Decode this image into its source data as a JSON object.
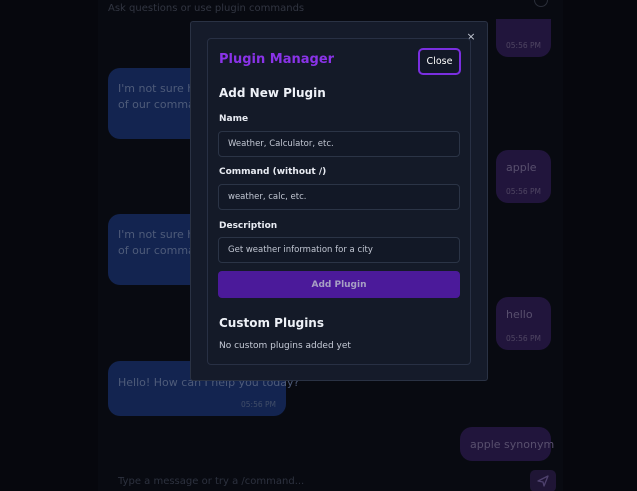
{
  "chat": {
    "subtitle": "Ask questions or use plugin commands",
    "messages": [
      {
        "role": "user",
        "text": "",
        "time": "05:56 PM"
      },
      {
        "role": "bot",
        "text": "I'm not sure how to\nof our commands",
        "time": ""
      },
      {
        "role": "user",
        "text": "apple",
        "time": "05:56 PM"
      },
      {
        "role": "bot",
        "text": "I'm not sure how to\nof our commands",
        "time": ""
      },
      {
        "role": "user",
        "text": "hello",
        "time": "05:56 PM"
      },
      {
        "role": "bot",
        "text": "Hello! How can I help you today?",
        "time": "05:56 PM"
      },
      {
        "role": "user",
        "text": "apple synonym",
        "time": ""
      }
    ],
    "input_placeholder": "Type a message or try a /command..."
  },
  "icons": {
    "header": "chevron-icon",
    "send": "send-icon",
    "modal_close": "close-x-icon"
  },
  "modal": {
    "x_glyph": "×",
    "title": "Plugin Manager",
    "close_label": "Close",
    "add_heading": "Add New Plugin",
    "fields": {
      "name": {
        "label": "Name",
        "placeholder": "Weather, Calculator, etc."
      },
      "command": {
        "label": "Command (without /)",
        "placeholder": "weather, calc, etc."
      },
      "description": {
        "label": "Description",
        "placeholder": "Get weather information for a city"
      }
    },
    "add_button": "Add Plugin",
    "custom_heading": "Custom Plugins",
    "empty_note": "No custom plugins added yet"
  },
  "colors": {
    "accent": "#8a33e8",
    "button": "#4b1a9a",
    "bot_bubble": "#1b3370",
    "user_bubble": "#2f1e54"
  }
}
